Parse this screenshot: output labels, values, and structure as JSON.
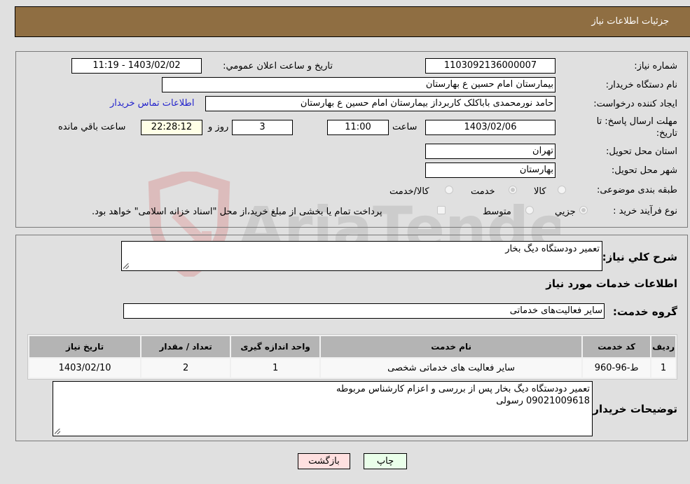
{
  "header": {
    "title": "جزئیات اطلاعات نیاز"
  },
  "info": {
    "need_number_label": "شماره نیاز:",
    "need_number": "1103092136000007",
    "announce_label": "تاریخ و ساعت اعلان عمومي:",
    "announce_value": "1403/02/02 - 11:19",
    "buyer_org_label": "نام دستگاه خریدار:",
    "buyer_org": "بیمارستان امام حسین  ع  بهارستان",
    "creator_label": "ایجاد کننده درخواست:",
    "creator": "حامد نورمحمدی باباکلک کاربرداز بیمارستان امام حسین  ع  بهارستان",
    "contact_link": "اطلاعات تماس خریدار",
    "deadline_label_line1": "مهلت ارسال پاسخ: تا",
    "deadline_label_line2": "تاریخ:",
    "deadline_date": "1403/02/06",
    "time_label": "ساعت",
    "deadline_time": "11:00",
    "days_value": "3",
    "days_label": "روز و",
    "remaining_time": "22:28:12",
    "remaining_label": "ساعت باقي مانده",
    "province_label": "استان محل تحویل:",
    "province": "تهران",
    "city_label": "شهر محل تحویل:",
    "city": "بهارستان",
    "category_label": "طبقه بندی موضوعی:",
    "category_options": [
      {
        "label": "کالا",
        "selected": false
      },
      {
        "label": "خدمت",
        "selected": true
      },
      {
        "label": "کالا/خدمت",
        "selected": false
      }
    ],
    "process_label": "نوع فرآیند خرید :",
    "process_options": [
      {
        "label": "جزيي",
        "selected": true
      },
      {
        "label": "متوسط",
        "selected": false
      }
    ],
    "payment_checkbox_label": "پرداخت تمام یا بخشی از مبلغ خرید،از محل \"اسناد خزانه اسلامی\" خواهد بود.",
    "payment_checked": false
  },
  "details": {
    "summary_label": "شرح کلي نیاز:",
    "summary_value": "تعمیر دودستگاه دیگ بخار",
    "services_heading": "اطلاعات خدمات مورد نیاز",
    "service_group_label": "گروه خدمت:",
    "service_group_value": "سایر فعالیت‌های خدماتی",
    "table": {
      "headers": [
        "ردیف",
        "کد خدمت",
        "نام خدمت",
        "واحد اندازه گیری",
        "تعداد / مقدار",
        "تاریخ نیاز"
      ],
      "rows": [
        [
          "1",
          "ط-96-960",
          "سایر فعالیت های خدماتی شخصی",
          "1",
          "2",
          "1403/02/10"
        ]
      ]
    },
    "buyer_notes_label": "توضیحات خریدار:",
    "buyer_notes_line1": "تعمیر دودستگاه دیگ بخار پس از بررسی و اعزام کارشناس مربوطه",
    "buyer_notes_line2": "09021009618 رسولی"
  },
  "buttons": {
    "print": "چاپ",
    "back": "بازگشت"
  },
  "colors": {
    "header_bg": "#8f6e42",
    "print_bg": "#eaffea",
    "back_bg": "#ffe0e0",
    "link": "#2222cc"
  },
  "watermark": {
    "text": "AriaTender.neT"
  }
}
